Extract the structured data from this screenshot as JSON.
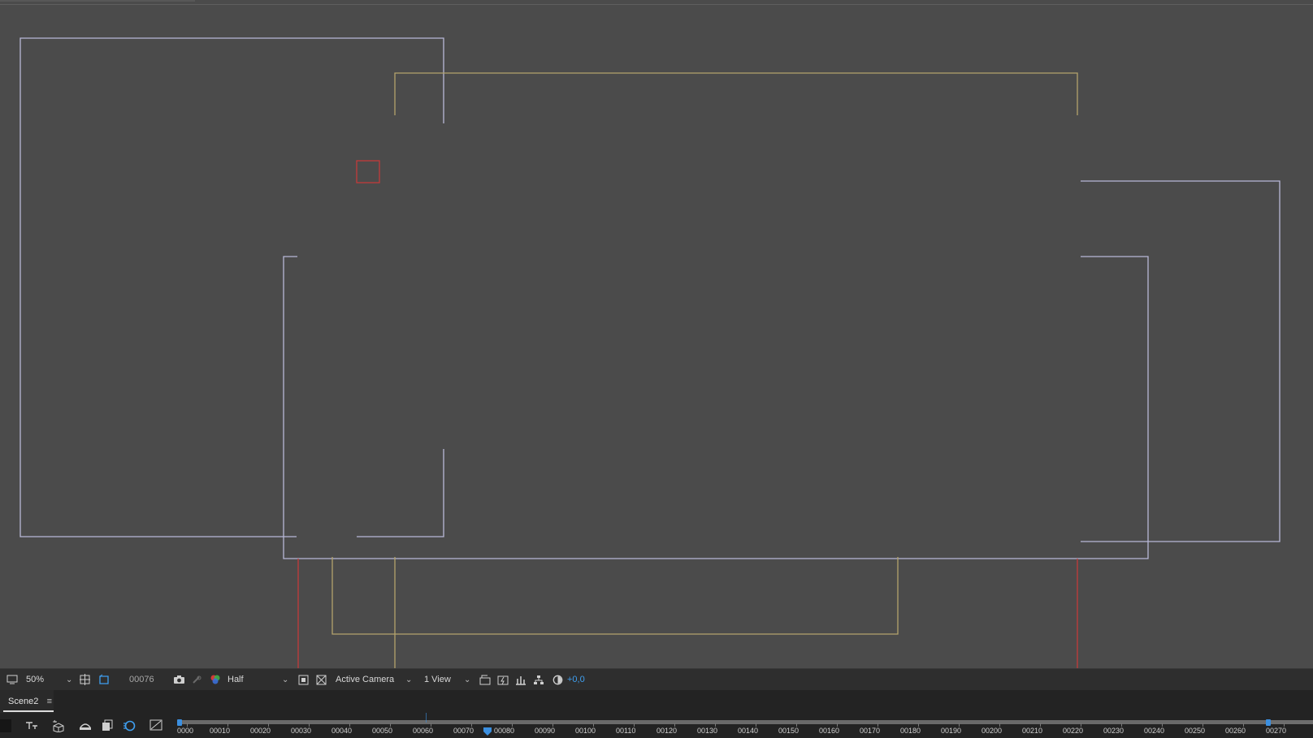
{
  "viewer": {
    "magnification": "50%",
    "current_frame": "00076",
    "resolution": "Half",
    "camera_view": "Active Camera",
    "view_layout": "1 View",
    "exposure": "+0,0",
    "accent_color": "#3f9ff0"
  },
  "icons": {
    "monitor": "monitor-icon",
    "magnification_arrow": "chevron-down-icon",
    "grid": "grid-guides-icon",
    "mask": "mask-visibility-icon",
    "snapshot": "camera-snapshot-icon",
    "show_snapshot": "show-snapshot-icon",
    "channel": "rgb-channel-icon",
    "region_of_interest": "region-of-interest-icon",
    "transparency_grid": "transparency-grid-icon",
    "pixel_aspect": "pixel-aspect-icon",
    "fast_previews": "fast-previews-icon",
    "timeline": "timeline-icon",
    "flowchart": "flowchart-icon",
    "reset_exposure": "reset-exposure-icon"
  },
  "timeline_panel": {
    "tab_name": "Scene2",
    "tab_menu": "≡",
    "ruler_labels": [
      "0000",
      "00010",
      "00020",
      "00030",
      "00040",
      "00050",
      "00060",
      "00070",
      "00080",
      "00090",
      "00100",
      "00110",
      "00120",
      "00130",
      "00140",
      "00150",
      "00160",
      "00170",
      "00180",
      "00190",
      "00200",
      "00210",
      "00220",
      "00230",
      "00240",
      "00250",
      "00260",
      "00270"
    ],
    "playhead_frame": 76
  },
  "scene_colors": {
    "layer_outline": "#b8b8d8",
    "camera_outline": "#b4a36c",
    "selected": "#c33a3a"
  }
}
